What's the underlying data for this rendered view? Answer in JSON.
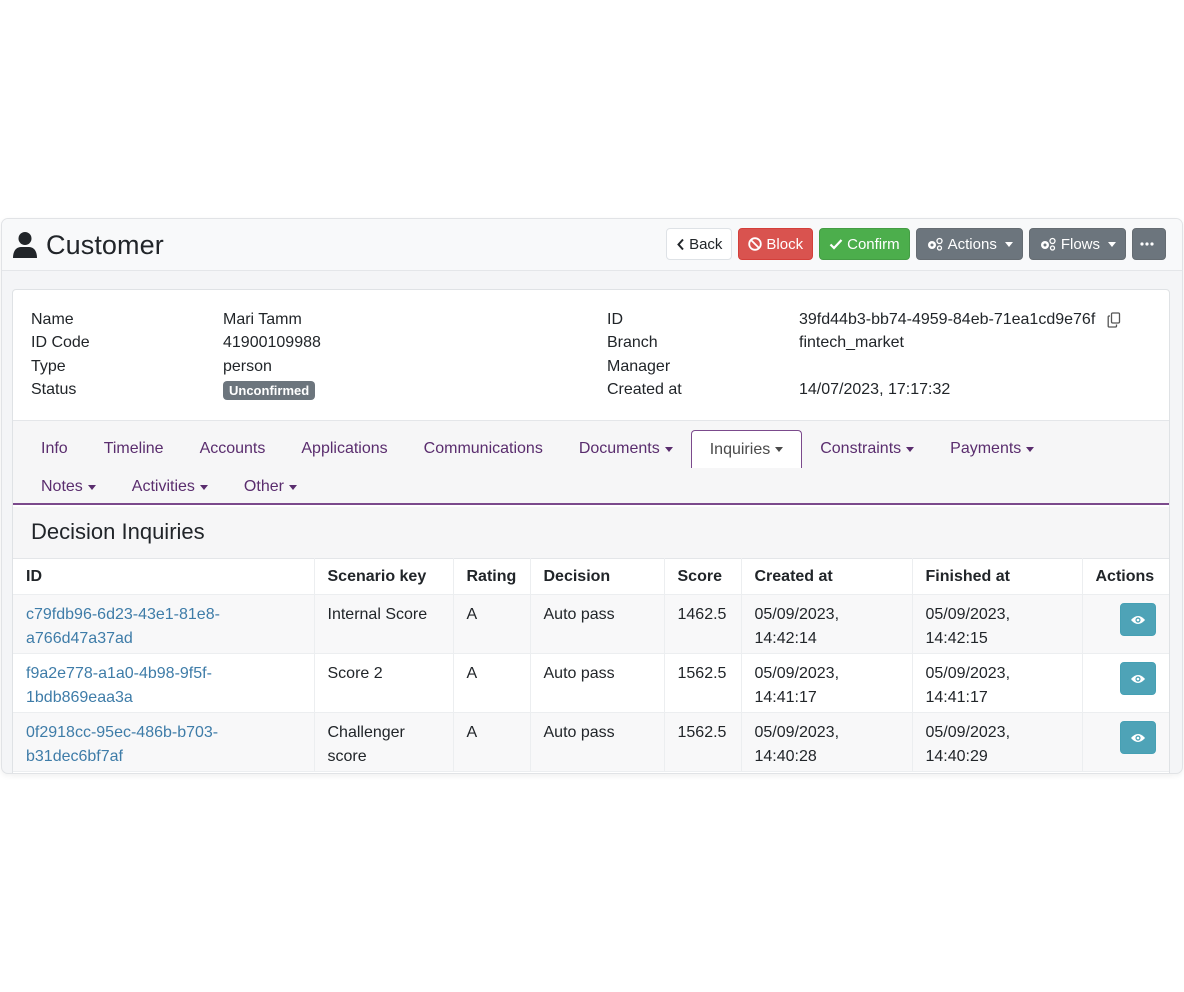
{
  "header": {
    "title": "Customer",
    "buttons": {
      "back": "Back",
      "block": "Block",
      "confirm": "Confirm",
      "actions": "Actions",
      "flows": "Flows"
    }
  },
  "customer": {
    "left": [
      {
        "label": "Name",
        "value": "Mari Tamm"
      },
      {
        "label": "ID Code",
        "value": "41900109988"
      },
      {
        "label": "Type",
        "value": "person"
      },
      {
        "label": "Status",
        "value": "Unconfirmed"
      }
    ],
    "right": [
      {
        "label": "ID",
        "value": "39fd44b3-bb74-4959-84eb-71ea1cd9e76f"
      },
      {
        "label": "Branch",
        "value": "fintech_market"
      },
      {
        "label": "Manager",
        "value": ""
      },
      {
        "label": "Created at",
        "value": "14/07/2023, 17:17:32"
      }
    ]
  },
  "tabs": {
    "row1": [
      {
        "label": "Info",
        "dropdown": false
      },
      {
        "label": "Timeline",
        "dropdown": false
      },
      {
        "label": "Accounts",
        "dropdown": false
      },
      {
        "label": "Applications",
        "dropdown": false
      },
      {
        "label": "Communications",
        "dropdown": false
      },
      {
        "label": "Documents",
        "dropdown": true
      },
      {
        "label": "Inquiries",
        "dropdown": true,
        "active": true
      },
      {
        "label": "Constraints",
        "dropdown": true
      },
      {
        "label": "Payments",
        "dropdown": true
      }
    ],
    "row2": [
      {
        "label": "Notes",
        "dropdown": true
      },
      {
        "label": "Activities",
        "dropdown": true
      },
      {
        "label": "Other",
        "dropdown": true
      }
    ]
  },
  "section": {
    "title": "Decision Inquiries"
  },
  "table": {
    "columns": [
      "ID",
      "Scenario key",
      "Rating",
      "Decision",
      "Score",
      "Created at",
      "Finished at",
      "Actions"
    ],
    "rows": [
      {
        "id_line1": "c79fdb96-6d23-43e1-81e8-",
        "id_line2": "a766d47a37ad",
        "scenario_line1": "Internal Score",
        "scenario_line2": "",
        "rating": "A",
        "decision": "Auto pass",
        "score": "1462.5",
        "created_line1": "05/09/2023,",
        "created_line2": "14:42:14",
        "finished_line1": "05/09/2023,",
        "finished_line2": "14:42:15"
      },
      {
        "id_line1": "f9a2e778-a1a0-4b98-9f5f-",
        "id_line2": "1bdb869eaa3a",
        "scenario_line1": "Score 2",
        "scenario_line2": "",
        "rating": "A",
        "decision": "Auto pass",
        "score": "1562.5",
        "created_line1": "05/09/2023,",
        "created_line2": "14:41:17",
        "finished_line1": "05/09/2023,",
        "finished_line2": "14:41:17"
      },
      {
        "id_line1": "0f2918cc-95ec-486b-b703-",
        "id_line2": "b31dec6bf7af",
        "scenario_line1": "Challenger",
        "scenario_line2": "score",
        "rating": "A",
        "decision": "Auto pass",
        "score": "1562.5",
        "created_line1": "05/09/2023,",
        "created_line2": "14:40:28",
        "finished_line1": "05/09/2023,",
        "finished_line2": "14:40:29"
      }
    ]
  },
  "colors": {
    "block": "#d9534f",
    "confirm": "#4cae4c",
    "secondary": "#6c757d",
    "tab_accent": "#7b4a8c",
    "link": "#3e7ca8",
    "view_button": "#4ea3b7"
  }
}
